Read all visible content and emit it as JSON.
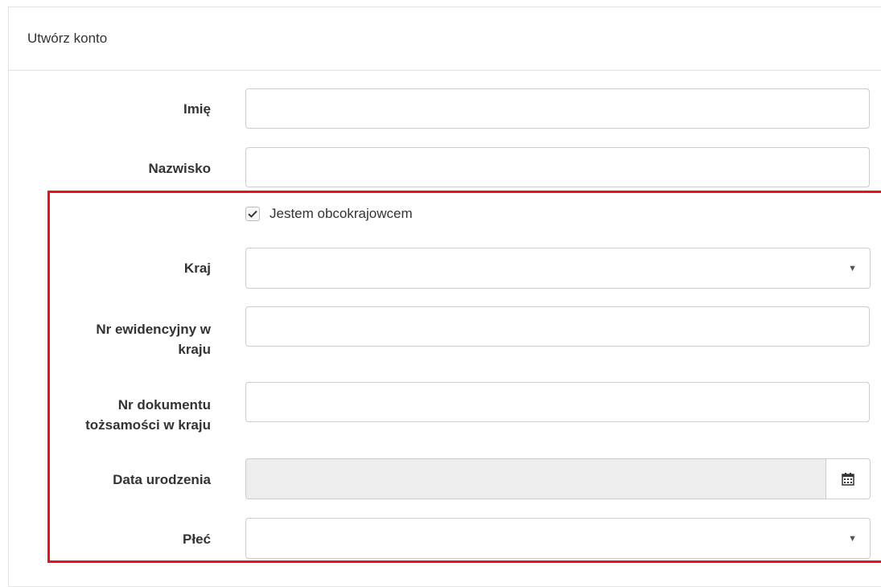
{
  "panel": {
    "title": "Utwórz konto"
  },
  "form": {
    "first_name": {
      "label": "Imię",
      "value": ""
    },
    "last_name": {
      "label": "Nazwisko",
      "value": ""
    },
    "foreigner_checkbox": {
      "label": "Jestem obcokrajowcem",
      "checked": true
    },
    "country": {
      "label": "Kraj",
      "value": ""
    },
    "registry_number": {
      "label_line1": "Nr ewidencyjny w",
      "label_line2": "kraju",
      "value": ""
    },
    "id_document_number": {
      "label_line1": "Nr dokumentu",
      "label_line2": "tożsamości w kraju",
      "value": ""
    },
    "birth_date": {
      "label": "Data urodzenia",
      "value": "",
      "icon": "calendar-icon"
    },
    "gender": {
      "label": "Płeć",
      "value": ""
    }
  },
  "highlight": {
    "color": "#e8131a"
  }
}
